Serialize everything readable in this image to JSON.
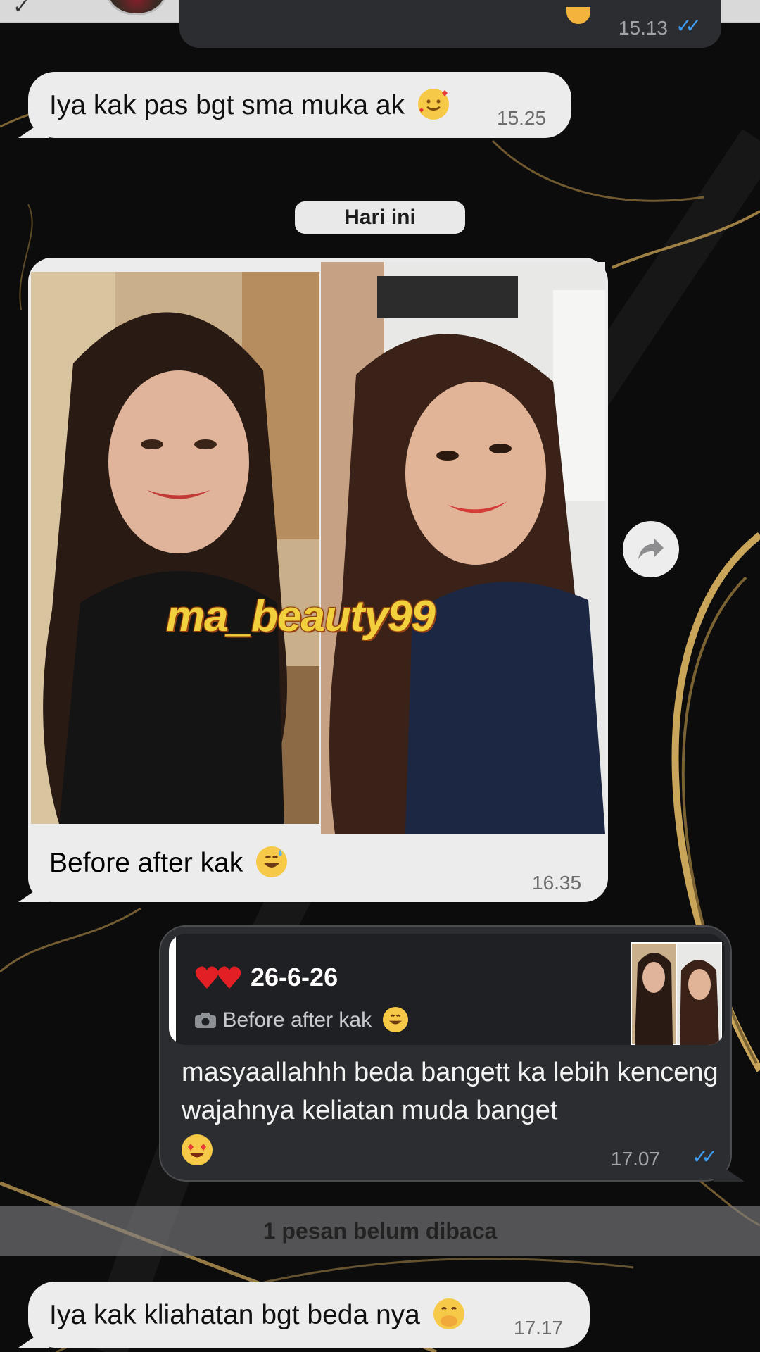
{
  "previous_message": {
    "time": "15.13"
  },
  "messages": [
    {
      "text": "Iya kak pas bgt sma muka ak",
      "emoji": "smiling-face-with-hearts",
      "time": "15.25"
    },
    {
      "text": "Before after kak",
      "emoji": "grinning-sweat",
      "time": "16.35"
    },
    {
      "text": "Iya kak kliahatan bgt beda nya",
      "emoji": "face-with-hand-over-mouth",
      "time": "17.17"
    }
  ],
  "date_separator": "Hari ini",
  "image_message": {
    "watermark": "ma_beauty99"
  },
  "reply_message": {
    "quoted_name": "26-6-26",
    "quoted_text": "Before after kak",
    "text": "masyaallahhh beda bangett ka lebih kenceng wajahnya keliatan muda banget",
    "emoji": "heart-eyes",
    "time": "17.07"
  },
  "unread_banner": "1 pesan belum dibaca",
  "colors": {
    "incoming_bubble": "#ececec",
    "outgoing_bubble": "#2b2d31",
    "read_ticks": "#3e9bf2",
    "watermark": "#f2cf3d"
  }
}
